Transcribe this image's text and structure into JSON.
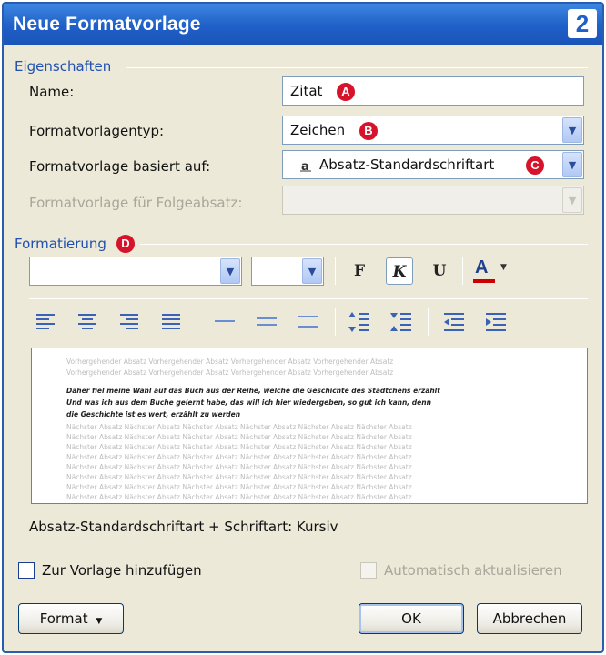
{
  "window": {
    "title": "Neue Formatvorlage",
    "step_badge": "2"
  },
  "eigenschaften": {
    "section_label": "Eigenschaften",
    "name_label": "Name:",
    "name_value": "Zitat",
    "typ_label": "Formatvorlagentyp:",
    "typ_value": "Zeichen",
    "basiert_label": "Formatvorlage basiert auf:",
    "basiert_value": "Absatz-Standardschriftart",
    "folge_label": "Formatvorlage für Folgeabsatz:",
    "folge_value": ""
  },
  "markers": {
    "a": "A",
    "b": "B",
    "c": "C",
    "d": "D"
  },
  "formatierung": {
    "section_label": "Formatierung",
    "font_value": "",
    "size_value": "",
    "bold_label": "F",
    "italic_label": "K",
    "underline_label": "U",
    "fontcolor_label": "A"
  },
  "preview": {
    "lines_before": [
      "Vorhergehender Absatz Vorhergehender Absatz Vorhergehender Absatz Vorhergehender Absatz",
      "Vorhergehender Absatz Vorhergehender Absatz Vorhergehender Absatz Vorhergehender Absatz"
    ],
    "sample_lines": [
      "Daher fiel meine Wahl auf das Buch aus der Reihe, welche die Geschichte des Städtchens erzählt",
      "Und was ich aus dem Buche gelernt habe, das will ich hier wiedergeben, so gut ich kann, denn",
      "die Geschichte ist es wert, erzählt zu werden"
    ],
    "lines_after": [
      "Nächster Absatz Nächster Absatz Nächster Absatz Nächster Absatz Nächster Absatz Nächster Absatz",
      "Nächster Absatz Nächster Absatz Nächster Absatz Nächster Absatz Nächster Absatz Nächster Absatz",
      "Nächster Absatz Nächster Absatz Nächster Absatz Nächster Absatz Nächster Absatz Nächster Absatz",
      "Nächster Absatz Nächster Absatz Nächster Absatz Nächster Absatz Nächster Absatz Nächster Absatz",
      "Nächster Absatz Nächster Absatz Nächster Absatz Nächster Absatz Nächster Absatz Nächster Absatz",
      "Nächster Absatz Nächster Absatz Nächster Absatz Nächster Absatz Nächster Absatz Nächster Absatz",
      "Nächster Absatz Nächster Absatz Nächster Absatz Nächster Absatz Nächster Absatz Nächster Absatz",
      "Nächster Absatz Nächster Absatz Nächster Absatz Nächster Absatz Nächster Absatz Nächster Absatz",
      "Nächster Absatz Nächster Absatz Nächster Absatz Nächster Absatz"
    ]
  },
  "description": "Absatz-Standardschriftart + Schriftart: Kursiv",
  "options": {
    "add_to_template_label": "Zur Vorlage hinzufügen",
    "add_to_template_checked": false,
    "auto_update_label": "Automatisch aktualisieren",
    "auto_update_checked": false
  },
  "buttons": {
    "format": "Format",
    "ok": "OK",
    "cancel": "Abbrechen"
  },
  "colors": {
    "title_bar": "#1f5fc8",
    "section_label": "#1f4fb0",
    "marker": "#d6132a",
    "font_color_bar": "#cc0000"
  }
}
